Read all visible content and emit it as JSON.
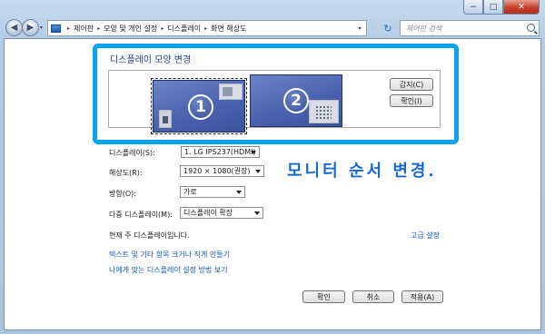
{
  "window": {
    "minimize": "−",
    "maximize": "□",
    "close": "✕"
  },
  "nav": {
    "back_icon": "arrow-left-icon",
    "forward_icon": "arrow-right-icon",
    "back": "◀",
    "forward": "▶",
    "history": "▾"
  },
  "address": {
    "root_marker": "▸",
    "breadcrumb": [
      "제어판",
      "모양 및 개인 설정",
      "디스플레이",
      "화면 해상도"
    ],
    "separator": "▸",
    "dropdown": "▾",
    "refresh": "↻"
  },
  "search": {
    "placeholder": "제어판 검색"
  },
  "panel": {
    "title": "디스플레이 모양 변경",
    "monitor1_number": "1",
    "monitor2_number": "2",
    "detect_button": "감지(C)",
    "identify_button": "확인(I)"
  },
  "annotation": {
    "text": "모니터 순서 변경.",
    "color": "#1769d2",
    "highlight_color": "#0ba3ee"
  },
  "form": {
    "display_label": "디스플레이(S):",
    "display_value": "1. LG IPS237(HDMI)",
    "resolution_label": "해상도(R):",
    "resolution_value": "1920 × 1080(권장)",
    "orientation_label": "방향(O):",
    "orientation_value": "가로",
    "multi_label": "다중 디스플레이(M):",
    "multi_value": "디스플레이 확장"
  },
  "status": {
    "current_display": "현재 주 디스플레이입니다.",
    "advanced_link": "고급 설정"
  },
  "links": {
    "text_size": "텍스트 및 기타 항목 크거나 작게 만들기",
    "help": "나에게 맞는 디스플레이 설정 방법 보기"
  },
  "footer": {
    "ok": "확인",
    "cancel": "취소",
    "apply": "적용(A)"
  }
}
